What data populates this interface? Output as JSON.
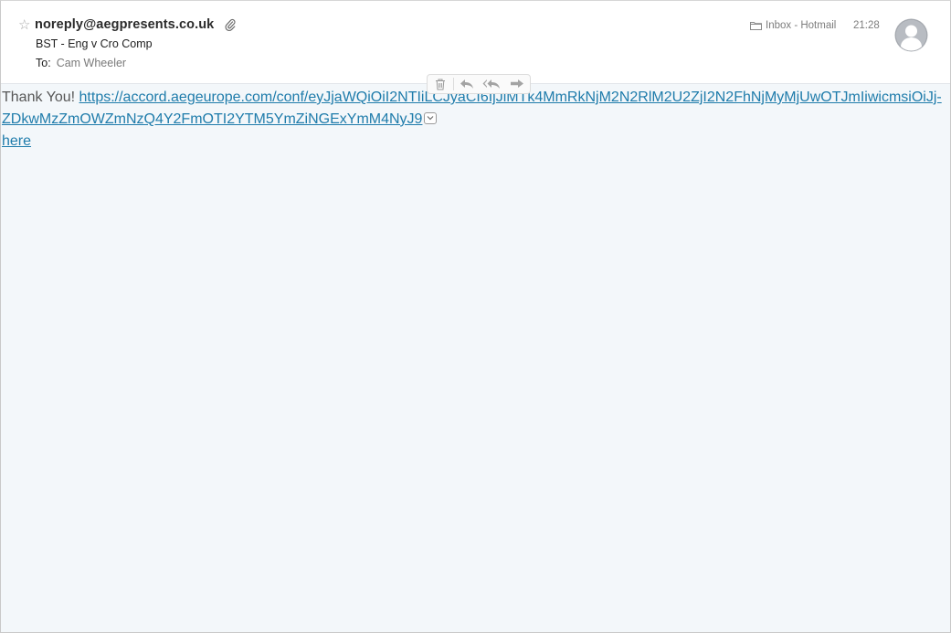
{
  "header": {
    "star_glyph": "☆",
    "from": "noreply@aegpresents.co.uk",
    "subject": "BST - Eng v Cro Comp",
    "to_label": "To:",
    "to_name": "Cam Wheeler",
    "folder": "Inbox - Hotmail",
    "time": "21:28",
    "icons": {
      "star": "star-icon",
      "attachment": "paperclip-icon",
      "folder": "folder-icon",
      "avatar": "avatar-icon"
    }
  },
  "toolbar": {
    "buttons": [
      "trash-icon",
      "reply-icon",
      "reply-all-icon",
      "forward-icon"
    ]
  },
  "message": {
    "greeting": "Thank You!",
    "link_text": "https://accord.aegeurope.com/conf/eyJjaWQiOiI2NTIiLCJyaCI6IjJiMTk4MmRkNjM2N2RlM2U2ZjI2N2FhNjMyMjUwOTJmIiwicmsiOiJj-ZDkwMzZmOWZmNzQ4Y2FmOTI2YTM5YmZiNGExYmM4NyJ9",
    "here": "here"
  },
  "colors": {
    "link": "#1f7cab",
    "body_background": "#f3f7fa",
    "text_gray": "#575757"
  }
}
